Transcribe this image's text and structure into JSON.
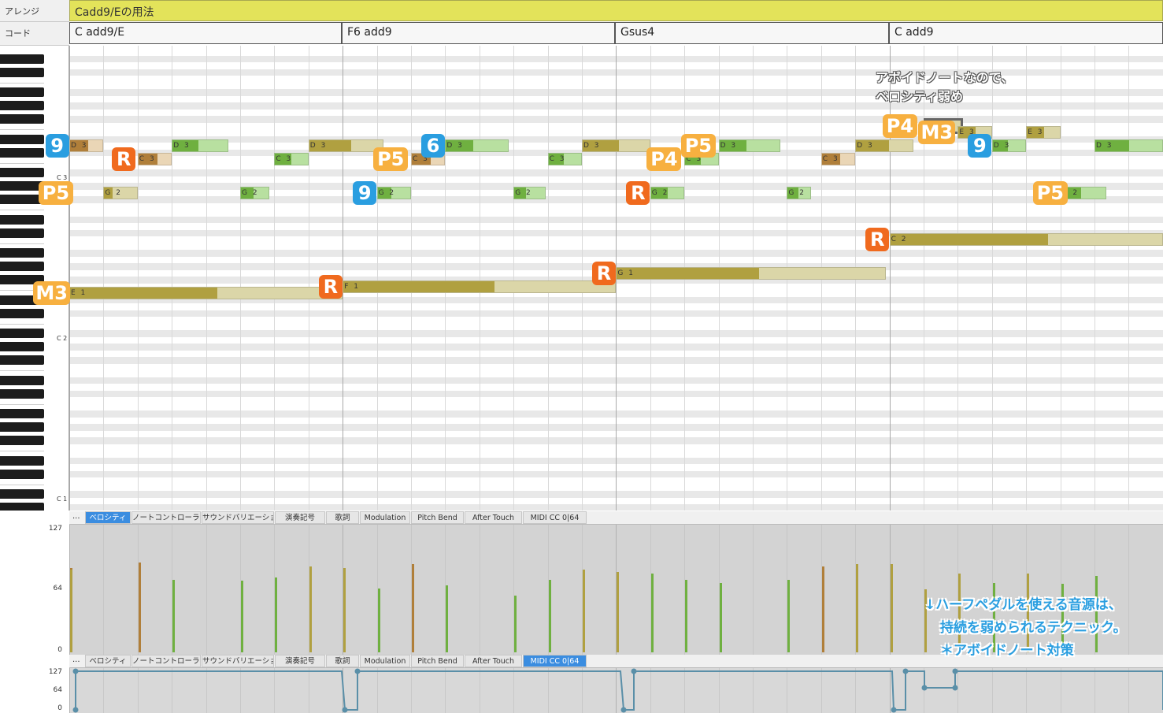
{
  "header": {
    "arrange_label": "アレンジ",
    "chord_label": "コード",
    "arrange_title": "Cadd9/Eの用法"
  },
  "chords": [
    "C add9/E",
    "F6 add9",
    "Gsus4",
    "C add9"
  ],
  "key_labels": [
    "C 3",
    "C 2",
    "C 1"
  ],
  "notes": [
    {
      "pitch": "D3",
      "label": "D 3",
      "beat": 0,
      "len": 1,
      "vel": 86,
      "color": "brown"
    },
    {
      "pitch": "C3",
      "label": "C 3",
      "beat": 2,
      "len": 1,
      "vel": 92,
      "color": "brown"
    },
    {
      "pitch": "D3",
      "label": "D 3",
      "beat": 3,
      "len": 1.65,
      "vel": 74,
      "color": "green"
    },
    {
      "pitch": "G2",
      "label": "G 2",
      "beat": 1,
      "len": 1,
      "vel": 0,
      "color": "olive"
    },
    {
      "pitch": "G2",
      "label": "G 2",
      "beat": 5,
      "len": 0.85,
      "vel": 73,
      "color": "green"
    },
    {
      "pitch": "C3",
      "label": "C 3",
      "beat": 6,
      "len": 1,
      "vel": 76,
      "color": "green"
    },
    {
      "pitch": "D3",
      "label": "D 3",
      "beat": 7,
      "len": 2.2,
      "vel": 88,
      "color": "olive"
    },
    {
      "pitch": "E1",
      "label": "E 1",
      "beat": 0,
      "len": 8,
      "vel": 84,
      "color": "olive"
    },
    {
      "pitch": "G2",
      "label": "G 2",
      "beat": 9,
      "len": 1,
      "vel": 65,
      "color": "green"
    },
    {
      "pitch": "C3",
      "label": "C 3",
      "beat": 10,
      "len": 1,
      "vel": 90,
      "color": "brown"
    },
    {
      "pitch": "D3",
      "label": "D 3",
      "beat": 11,
      "len": 1.85,
      "vel": 68,
      "color": "green"
    },
    {
      "pitch": "G2",
      "label": "G 2",
      "beat": 13,
      "len": 0.95,
      "vel": 58,
      "color": "green"
    },
    {
      "pitch": "C3",
      "label": "C 3",
      "beat": 14,
      "len": 1,
      "vel": 74,
      "color": "green"
    },
    {
      "pitch": "D3",
      "label": "D 3",
      "beat": 15,
      "len": 2,
      "vel": 84,
      "color": "olive"
    },
    {
      "pitch": "F1",
      "label": "F 1",
      "beat": 8,
      "len": 8,
      "vel": 86,
      "color": "olive"
    },
    {
      "pitch": "G2",
      "label": "G 2",
      "beat": 17,
      "len": 1,
      "vel": 80,
      "color": "green"
    },
    {
      "pitch": "C3",
      "label": "C 3",
      "beat": 18,
      "len": 1,
      "vel": 74,
      "color": "green"
    },
    {
      "pitch": "D3",
      "label": "D 3",
      "beat": 19,
      "len": 1.8,
      "vel": 71,
      "color": "green"
    },
    {
      "pitch": "G2",
      "label": "G 2",
      "beat": 21,
      "len": 0.7,
      "vel": 74,
      "color": "green"
    },
    {
      "pitch": "C3",
      "label": "C 3",
      "beat": 22,
      "len": 1,
      "vel": 88,
      "color": "brown"
    },
    {
      "pitch": "D3",
      "label": "D 3",
      "beat": 23,
      "len": 1.7,
      "vel": 90,
      "color": "olive"
    },
    {
      "pitch": "G1",
      "label": "G 1",
      "beat": 16,
      "len": 7.9,
      "vel": 82,
      "color": "olive"
    },
    {
      "pitch": "C2",
      "label": "C 2",
      "beat": 24,
      "len": 8,
      "vel": 90,
      "color": "olive"
    },
    {
      "pitch": "F3",
      "label": "F 3",
      "beat": 25,
      "len": 1.15,
      "vel": 64,
      "color": "olive"
    },
    {
      "pitch": "E3",
      "label": "E 3",
      "beat": 26,
      "len": 1,
      "vel": 80,
      "color": "olive"
    },
    {
      "pitch": "D3",
      "label": "D 3",
      "beat": 27,
      "len": 1,
      "vel": 71,
      "color": "green"
    },
    {
      "pitch": "E3",
      "label": "E 3",
      "beat": 28,
      "len": 1,
      "vel": 80,
      "color": "olive"
    },
    {
      "pitch": "G2",
      "label": "G 2",
      "beat": 29,
      "len": 1.35,
      "vel": 70,
      "color": "green"
    },
    {
      "pitch": "D3",
      "label": "D 3",
      "beat": 30,
      "len": 2,
      "vel": 78,
      "color": "green"
    }
  ],
  "badges": [
    {
      "text": "9",
      "color": "#2a9ee0",
      "pitch": "D3",
      "beat": -0.7
    },
    {
      "text": "R",
      "color": "#f06a1e",
      "pitch": "C3",
      "beat": 1.25
    },
    {
      "text": "P5",
      "color": "#f7b040",
      "pitch": "G2",
      "beat": -0.9
    },
    {
      "text": "M3",
      "color": "#f7b040",
      "pitch": "E1",
      "beat": -1.05
    },
    {
      "text": "R",
      "color": "#f06a1e",
      "pitch": "F1",
      "beat": 7.3
    },
    {
      "text": "9",
      "color": "#2a9ee0",
      "pitch": "G2",
      "beat": 8.3
    },
    {
      "text": "P5",
      "color": "#f7b040",
      "pitch": "C3",
      "beat": 8.9
    },
    {
      "text": "6",
      "color": "#2a9ee0",
      "pitch": "D3",
      "beat": 10.3
    },
    {
      "text": "R",
      "color": "#f06a1e",
      "pitch": "G1",
      "beat": 15.3
    },
    {
      "text": "R",
      "color": "#f06a1e",
      "pitch": "G2",
      "beat": 16.3
    },
    {
      "text": "P4",
      "color": "#f7b040",
      "pitch": "C3",
      "beat": 16.9
    },
    {
      "text": "P5",
      "color": "#f7b040",
      "pitch": "D3",
      "beat": 17.9
    },
    {
      "text": "R",
      "color": "#f06a1e",
      "pitch": "C2",
      "beat": 23.3
    },
    {
      "text": "P4",
      "color": "#f7b040",
      "pitch": "F3",
      "beat": 23.8
    },
    {
      "text": "M3",
      "color": "#f7b040",
      "pitch": "E3",
      "beat": 24.85
    },
    {
      "text": "9",
      "color": "#2a9ee0",
      "pitch": "D3",
      "beat": 26.3
    },
    {
      "text": "P5",
      "color": "#f7b040",
      "pitch": "G2",
      "beat": 28.2
    }
  ],
  "annotations": {
    "avoid_line1": "アボイドノートなので、",
    "avoid_line2": "ベロシティ弱め",
    "half_pedal_line1": "↓ハーフペダルを使える音源は、",
    "half_pedal_line2": "持続を弱められるテクニック。",
    "half_pedal_line3": "＊アボイドノート対策"
  },
  "tabs": {
    "more": "...",
    "items": [
      "ベロシティ",
      "ノートコントローラー",
      "サウンドバリエーション",
      "演奏記号",
      "歌詞",
      "Modulation",
      "Pitch Bend",
      "After Touch",
      "MIDI CC 0|64"
    ]
  },
  "velocity_lane": {
    "active_tab": 0,
    "max": "127",
    "mid": "64",
    "min": "0"
  },
  "cc_lane": {
    "active_tab": 8,
    "max": "127",
    "mid": "64",
    "min": "0"
  },
  "colors": {
    "blue_badge": "#2a9ee0",
    "red_badge": "#f06a1e",
    "orange_badge": "#f7b040",
    "arrange": "#e3e35a",
    "tab_active": "#3b8de0"
  }
}
